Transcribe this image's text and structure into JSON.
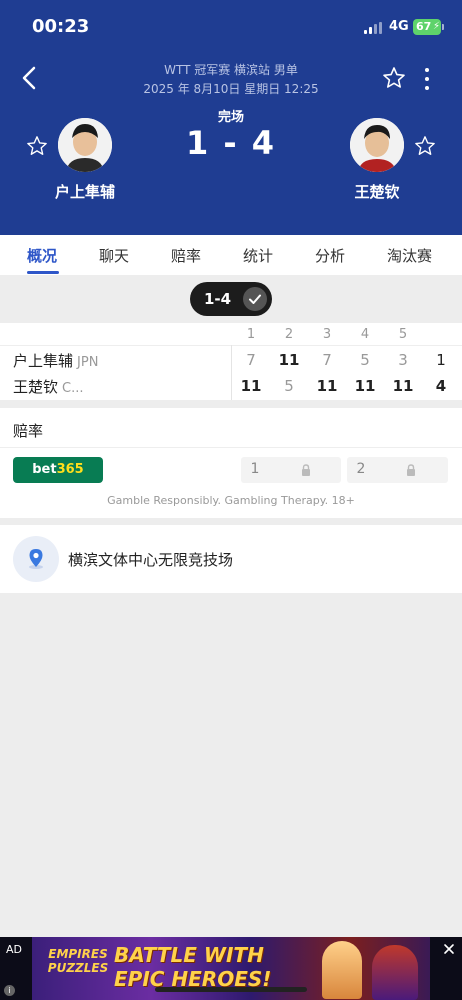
{
  "status_bar": {
    "time": "00:23",
    "network": "4G",
    "battery": "67"
  },
  "header": {
    "competition": "WTT 冠军赛 横滨站 男单",
    "datetime": "2025 年 8月10日 星期日 12:25",
    "status": "完场",
    "score": "1 - 4",
    "home": {
      "name": "户上隼辅"
    },
    "away": {
      "name": "王楚钦"
    }
  },
  "tabs": [
    "概况",
    "聊天",
    "赔率",
    "统计",
    "分析",
    "淘汰赛"
  ],
  "set_selector": {
    "label": "1-4"
  },
  "score_table": {
    "set_headers": [
      "1",
      "2",
      "3",
      "4",
      "5"
    ],
    "rows": [
      {
        "name": "户上隼辅",
        "country": "JPN",
        "sets": [
          "7",
          "11",
          "7",
          "5",
          "3"
        ],
        "total": "1"
      },
      {
        "name": "王楚钦",
        "country": "C...",
        "sets": [
          "11",
          "5",
          "11",
          "11",
          "11"
        ],
        "total": "4"
      }
    ]
  },
  "odds": {
    "title": "赔率",
    "bookmaker_a": "bet",
    "bookmaker_b": "365",
    "option1": "1",
    "option2": "2",
    "note": "Gamble Responsibly. Gambling Therapy. 18+"
  },
  "venue": {
    "name": "横滨文体中心无限竞技场"
  },
  "ad": {
    "tag": "AD",
    "brand": "EMPIRES PUZZLES",
    "headline": "BATTLE WITH EPIC HEROES!"
  },
  "colors": {
    "header_bg": "#1f3d92",
    "accent": "#2e56c8",
    "bet365_green": "#087c53",
    "battery_green": "#5ed36b"
  }
}
